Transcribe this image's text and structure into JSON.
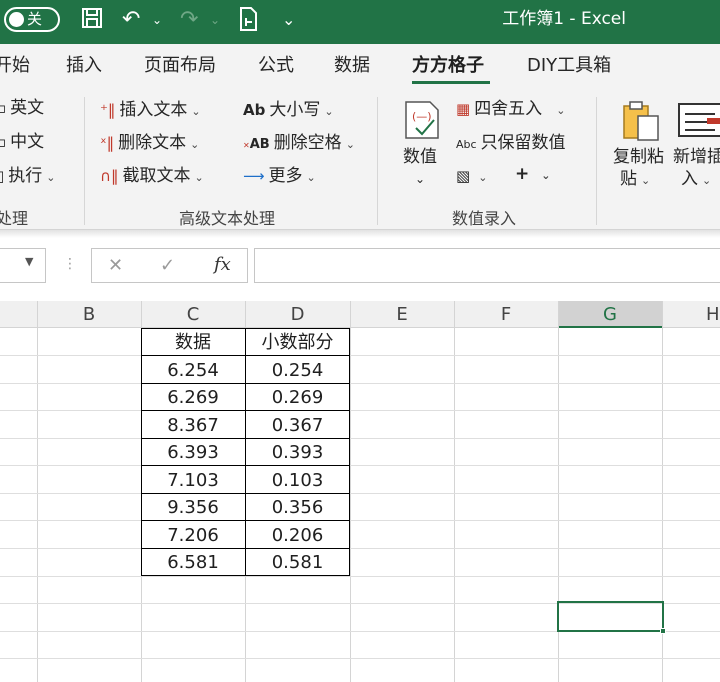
{
  "titlebar": {
    "autosave_label": "关",
    "title": "工作簿1  -  Excel"
  },
  "tabs": [
    "开始",
    "插入",
    "页面布局",
    "公式",
    "数据",
    "方方格子",
    "DIY工具箱"
  ],
  "ribbon": {
    "group1": {
      "items": [
        "英文",
        "中文",
        "执行"
      ],
      "label": "处理"
    },
    "group2": {
      "col1": [
        "插入文本",
        "删除文本",
        "截取文本"
      ],
      "col2": [
        "大小写",
        "删除空格",
        "更多"
      ],
      "label": "高级文本处理"
    },
    "group3": {
      "big_button": "数值",
      "round": "四舍五入",
      "keep_value": "只保留数值",
      "abc": "Abc",
      "label": "数值录入"
    },
    "group4": {
      "copy_paste_1": "复制粘",
      "copy_paste_2": "贴",
      "new_insert_1": "新增插",
      "new_insert_2": "入"
    },
    "icons": {
      "ab": "Ab",
      "xab": "AB"
    }
  },
  "formula": {
    "cancel": "✕",
    "confirm": "✓",
    "fx": "fx"
  },
  "columns": [
    "B",
    "C",
    "D",
    "E",
    "F",
    "G",
    "H"
  ],
  "table": {
    "headers": [
      "数据",
      "小数部分"
    ],
    "rows": [
      [
        "6.254",
        "0.254"
      ],
      [
        "6.269",
        "0.269"
      ],
      [
        "8.367",
        "0.367"
      ],
      [
        "6.393",
        "0.393"
      ],
      [
        "7.103",
        "0.103"
      ],
      [
        "9.356",
        "0.356"
      ],
      [
        "7.206",
        "0.206"
      ],
      [
        "6.581",
        "0.581"
      ]
    ]
  },
  "colors": {
    "accent": "#217346"
  }
}
